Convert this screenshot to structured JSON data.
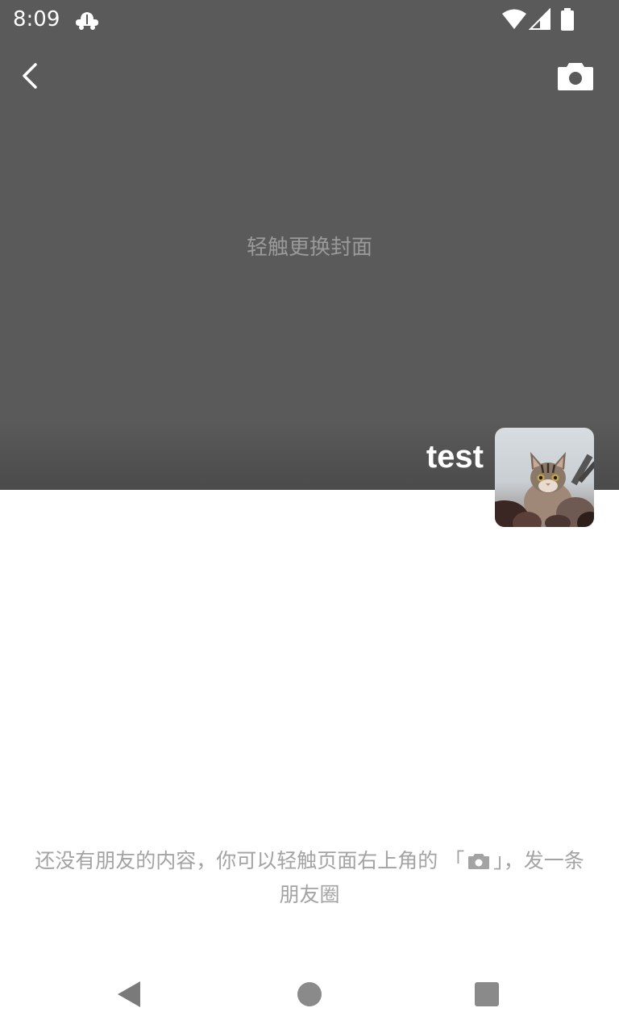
{
  "status_bar": {
    "time": "8:09",
    "icons": [
      "app-notification-icon",
      "wifi-icon",
      "cellular-signal-icon",
      "battery-icon"
    ]
  },
  "header": {
    "back_icon": "chevron-left-icon",
    "camera_icon": "camera-icon"
  },
  "cover": {
    "hint": "轻触更换封面",
    "background_color": "#5a5a5a"
  },
  "profile": {
    "name": "test",
    "avatar": "cat-photo-avatar"
  },
  "empty_state": {
    "text_before": "还没有朋友的内容，你可以轻触页面右上角的 「",
    "text_after": "」，发一条朋友圈",
    "icon": "camera-icon"
  },
  "nav_bar": {
    "icons": [
      "back-triangle-icon",
      "home-circle-icon",
      "recents-square-icon"
    ]
  }
}
